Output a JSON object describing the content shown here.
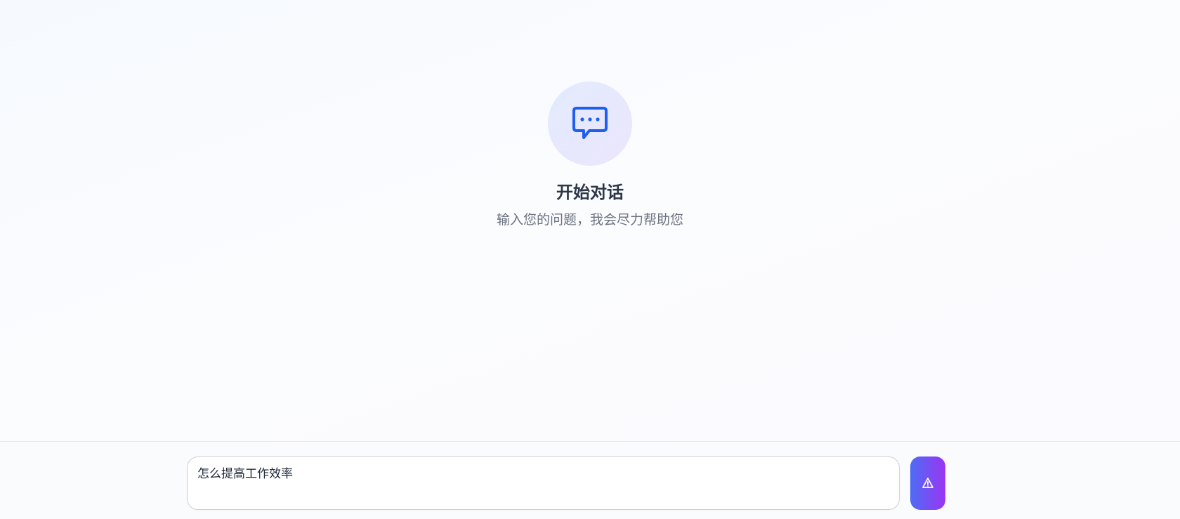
{
  "empty_state": {
    "icon": "chat-bubble-dots-icon",
    "title": "开始对话",
    "subtitle": "输入您的问题，我会尽力帮助您"
  },
  "composer": {
    "input_value": "怎么提高工作效率",
    "send_icon": "send-icon"
  },
  "colors": {
    "accent_blue": "#1f5ff0",
    "send_gradient_start": "#4f6cf5",
    "send_gradient_end": "#9a35f2",
    "title_text": "#2d3748",
    "subtitle_text": "#6b7280"
  }
}
